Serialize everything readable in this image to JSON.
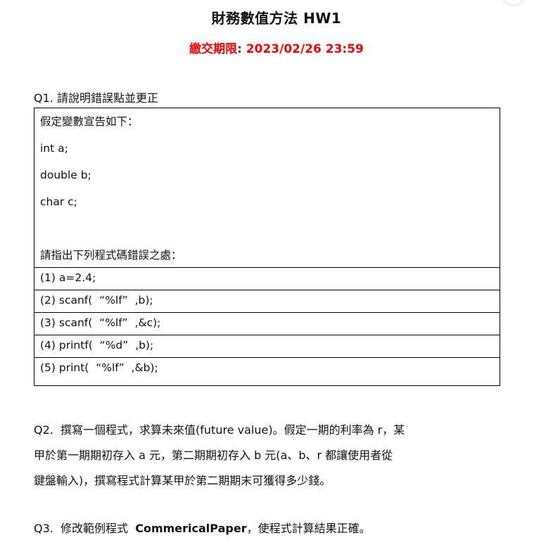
{
  "title": "財務數值方法  HW1",
  "deadline": "繳交期限: 2023/02/26 23:59",
  "q1": {
    "heading": "Q1.  請說明錯誤點並更正",
    "lines": [
      "假定變數宣告如下：",
      "int a;",
      "double b;",
      "char c;",
      "",
      "請指出下列程式碼錯誤之處：",
      "(1) a=2.4;",
      "(2) scanf(  “%lf”  ,b);",
      "(3) scanf(  “%lf”  ,&c);",
      "(4) printf(  “%d”  ,b);",
      "(5) print(  “%lf”  ,&b);"
    ]
  },
  "q2": {
    "lines": [
      "Q2.  撰寫一個程式，求算未來值(future value)。假定一期的利率為 r，某",
      "甲於第一期期初存入 a 元，第二期期初存入 b 元(a、b、r 都讓使用者從",
      "鍵盤輸入)，撰寫程式計算某甲於第二期期末可獲得多少錢。"
    ]
  },
  "q3": {
    "prefix": "Q3.  修改範例程式  ",
    "program": "CommericalPaper",
    "suffix": "，使程式計算結果正確。"
  }
}
